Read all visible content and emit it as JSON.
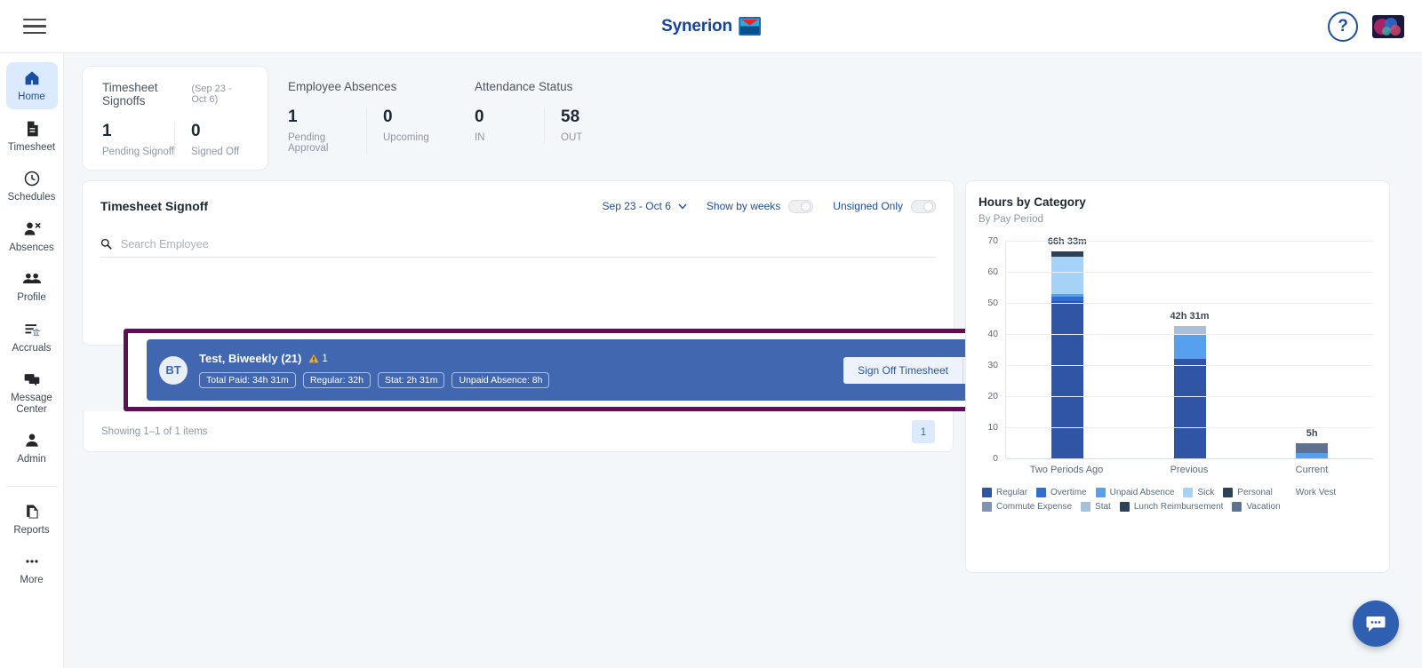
{
  "header": {
    "menu_icon": "hamburger-icon",
    "brand_text": "Synerion",
    "help_icon": "?",
    "avatar_icon": "user-avatar"
  },
  "sidebar": {
    "items": [
      {
        "label": "Home",
        "icon": "home-icon",
        "active": true
      },
      {
        "label": "Timesheet",
        "icon": "document-icon",
        "active": false
      },
      {
        "label": "Schedules",
        "icon": "clock-icon",
        "active": false
      },
      {
        "label": "Absences",
        "icon": "person-remove-icon",
        "active": false
      },
      {
        "label": "Profile",
        "icon": "people-icon",
        "active": false
      },
      {
        "label": "Accruals",
        "icon": "list-bank-icon",
        "active": false
      },
      {
        "label": "Message Center",
        "icon": "chat-icon",
        "active": false
      },
      {
        "label": "Admin",
        "icon": "person-icon",
        "active": false
      }
    ],
    "bottom_items": [
      {
        "label": "Reports",
        "icon": "copy-page-icon"
      },
      {
        "label": "More",
        "icon": "ellipsis-icon"
      }
    ]
  },
  "stats": [
    {
      "title": "Timesheet Signoffs",
      "range": "(Sep 23 - Oct 6)",
      "boxed": true,
      "columns": [
        {
          "value": "1",
          "label": "Pending Signoff"
        },
        {
          "value": "0",
          "label": "Signed Off"
        }
      ]
    },
    {
      "title": "Employee Absences",
      "range": "",
      "boxed": false,
      "columns": [
        {
          "value": "1",
          "label": "Pending Approval"
        },
        {
          "value": "0",
          "label": "Upcoming"
        }
      ]
    },
    {
      "title": "Attendance Status",
      "range": "",
      "boxed": false,
      "columns": [
        {
          "value": "0",
          "label": "IN"
        },
        {
          "value": "58",
          "label": "OUT"
        }
      ]
    }
  ],
  "signoff_panel": {
    "title": "Timesheet Signoff",
    "date_range": "Sep 23 - Oct 6",
    "chevron_icon": "chevron-down-icon",
    "show_by_weeks_label": "Show by weeks",
    "show_by_weeks_on": false,
    "unsigned_only_label": "Unsigned Only",
    "unsigned_only_on": false,
    "search_placeholder": "Search Employee",
    "search_value": "",
    "search_icon": "search-icon",
    "employee": {
      "initials": "BT",
      "name": "Test, Biweekly (21)",
      "warning_icon": "warning-triangle-icon",
      "warning_count": "1",
      "chips": [
        "Total Paid: 34h 31m",
        "Regular: 32h",
        "Stat: 2h 31m",
        "Unpaid Absence: 8h"
      ],
      "action_label": "Sign Off Timesheet",
      "action_caret_icon": "chevron-down-icon"
    },
    "footer_text": "Showing 1–1 of 1 items",
    "page_number": "1"
  },
  "chart_card": {
    "title": "Hours by Category",
    "subtitle": "By Pay Period"
  },
  "chart_data": {
    "type": "bar",
    "stacked": true,
    "title": "Hours by Category",
    "subtitle": "By Pay Period",
    "xlabel": "",
    "ylabel": "",
    "ylim": [
      0,
      70
    ],
    "yticks": [
      0,
      10,
      20,
      30,
      40,
      50,
      60,
      70
    ],
    "grid": true,
    "legend_position": "bottom",
    "categories": [
      "Two Periods Ago",
      "Previous",
      "Current"
    ],
    "bar_labels": [
      "66h 33m",
      "42h 31m",
      "5h"
    ],
    "totals": [
      66.55,
      42.52,
      5.0
    ],
    "series": [
      {
        "name": "Regular",
        "color": "#2f55a4",
        "values": [
          50.5,
          32.0,
          0
        ]
      },
      {
        "name": "Overtime",
        "color": "#2f6fd0",
        "values": [
          1.5,
          0,
          0
        ]
      },
      {
        "name": "Unpaid Absence",
        "color": "#56a0ee",
        "values": [
          1.0,
          8.0,
          1.6
        ]
      },
      {
        "name": "Sick",
        "color": "#a5d2f7",
        "values": [
          12.0,
          0,
          0
        ]
      },
      {
        "name": "Personal",
        "color": "#2e4257",
        "values": [
          0,
          0,
          0
        ]
      },
      {
        "name": "Work Vest",
        "color": "#4a6party",
        "values": [
          0,
          0,
          0
        ]
      },
      {
        "name": "Commute Expense",
        "color": "#7c95b5",
        "values": [
          0,
          0,
          0
        ]
      },
      {
        "name": "Stat",
        "color": "#a9c0dc",
        "values": [
          0,
          2.52,
          0
        ]
      },
      {
        "name": "Lunch Reimbursement",
        "color": "#2e4257",
        "values": [
          1.55,
          0,
          0
        ]
      },
      {
        "name": "Vacation",
        "color": "#5f7391",
        "values": [
          0,
          0,
          3.4
        ]
      }
    ],
    "legend": [
      {
        "label": "Regular",
        "color": "#2f55a4"
      },
      {
        "label": "Overtime",
        "color": "#2f6fd0"
      },
      {
        "label": "Unpaid Absence",
        "color": "#56a0ee"
      },
      {
        "label": "Sick",
        "color": "#a5d2f7"
      },
      {
        "label": "Personal",
        "color": "#2e4257"
      },
      {
        "label": "Work Vest",
        "color": "#4a6party"
      },
      {
        "label": "Commute Expense",
        "color": "#7c95b5"
      },
      {
        "label": "Stat",
        "color": "#a9c0dc"
      },
      {
        "label": "Lunch Reimbursement",
        "color": "#2e4257"
      },
      {
        "label": "Vacation",
        "color": "#5f7391"
      }
    ]
  },
  "fab": {
    "icon": "chat-bubble-icon"
  }
}
